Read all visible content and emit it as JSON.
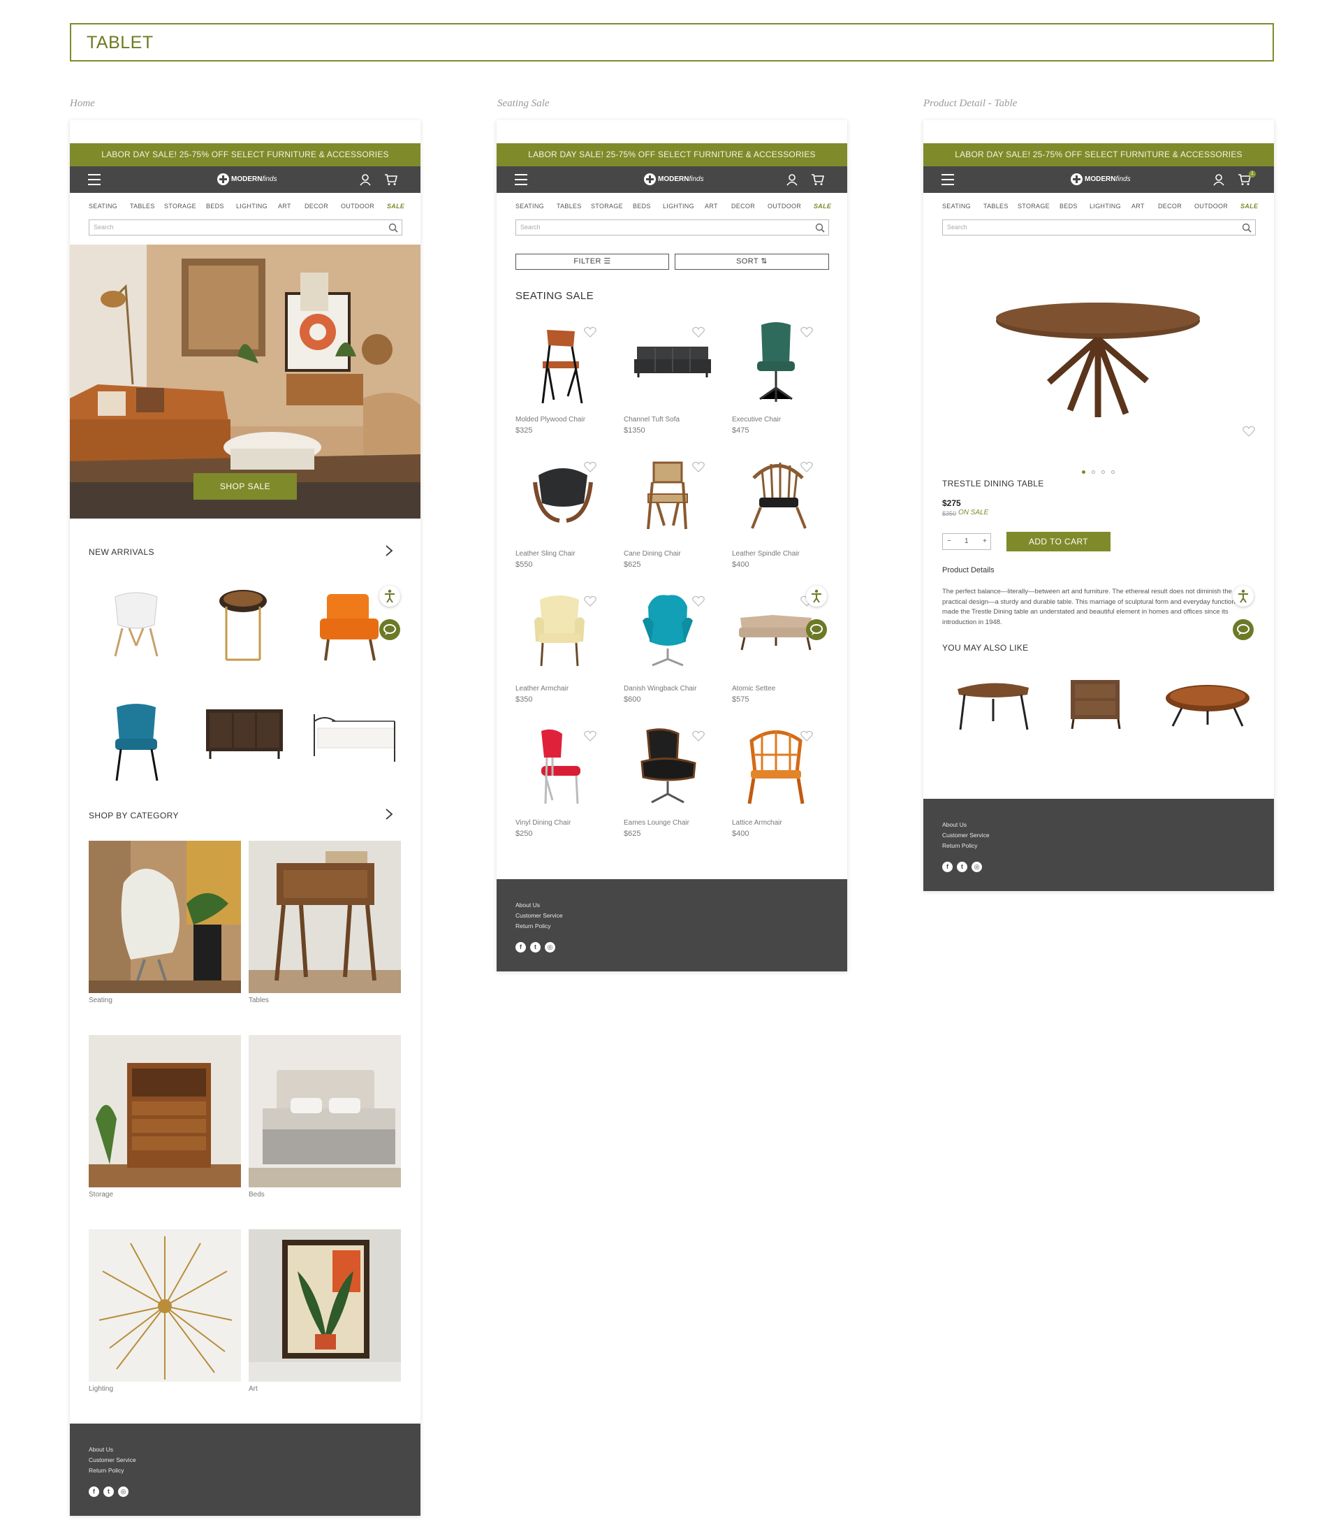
{
  "page_title": "TABLET",
  "columns": {
    "home": "Home",
    "seating": "Seating Sale",
    "detail": "Product Detail - Table"
  },
  "banner": "LABOR DAY SALE! 25-75% OFF SELECT FURNITURE & ACCESSORIES",
  "logo": {
    "brand": "MODERN",
    "suffix": "finds"
  },
  "nav_items": [
    "SEATING",
    "TABLES",
    "STORAGE",
    "BEDS",
    "LIGHTING",
    "ART",
    "DECOR",
    "OUTDOOR",
    "SALE"
  ],
  "search_placeholder": "Search",
  "cart_count": "1",
  "footer": {
    "links": [
      "About Us",
      "Customer Service",
      "Return Policy"
    ]
  },
  "colors": {
    "brand": "#7f8a2a",
    "dark": "#474747"
  },
  "home": {
    "hero_button": "SHOP SALE",
    "new_arrivals": "NEW ARRIVALS",
    "shop_by_category": "SHOP BY CATEGORY",
    "categories": [
      "Seating",
      "Tables",
      "Storage",
      "Beds",
      "Lighting",
      "Art"
    ]
  },
  "seating": {
    "filter": "FILTER",
    "sort": "SORT",
    "heading": "SEATING SALE",
    "products": [
      {
        "name": "Molded Plywood Chair",
        "price": "$325"
      },
      {
        "name": "Channel Tuft Sofa",
        "price": "$1350"
      },
      {
        "name": "Executive Chair",
        "price": "$475"
      },
      {
        "name": "Leather Sling Chair",
        "price": "$550"
      },
      {
        "name": "Cane Dining Chair",
        "price": "$625"
      },
      {
        "name": "Leather Spindle Chair",
        "price": "$400"
      },
      {
        "name": "Leather Armchair",
        "price": "$350"
      },
      {
        "name": "Danish Wingback Chair",
        "price": "$600"
      },
      {
        "name": "Atomic Settee",
        "price": "$575"
      },
      {
        "name": "Vinyl Dining Chair",
        "price": "$250"
      },
      {
        "name": "Eames Lounge Chair",
        "price": "$625"
      },
      {
        "name": "Lattice Armchair",
        "price": "$400"
      }
    ]
  },
  "detail": {
    "name": "TRESTLE DINING TABLE",
    "price": "$275",
    "old_price": "$350",
    "on_sale": "ON SALE",
    "qty": "1",
    "minus": "−",
    "plus": "+",
    "add_to_cart": "ADD TO CART",
    "details_heading": "Product Details",
    "description": "The perfect balance—literally—between art and furniture. The ethereal result does not diminish the practical design—a sturdy and durable table. This marriage of sculptural form and everyday function has made the Trestle Dining table an understated and beautiful element in homes and offices since its introduction in 1948.",
    "you_may_also_like": "YOU MAY ALSO LIKE"
  }
}
